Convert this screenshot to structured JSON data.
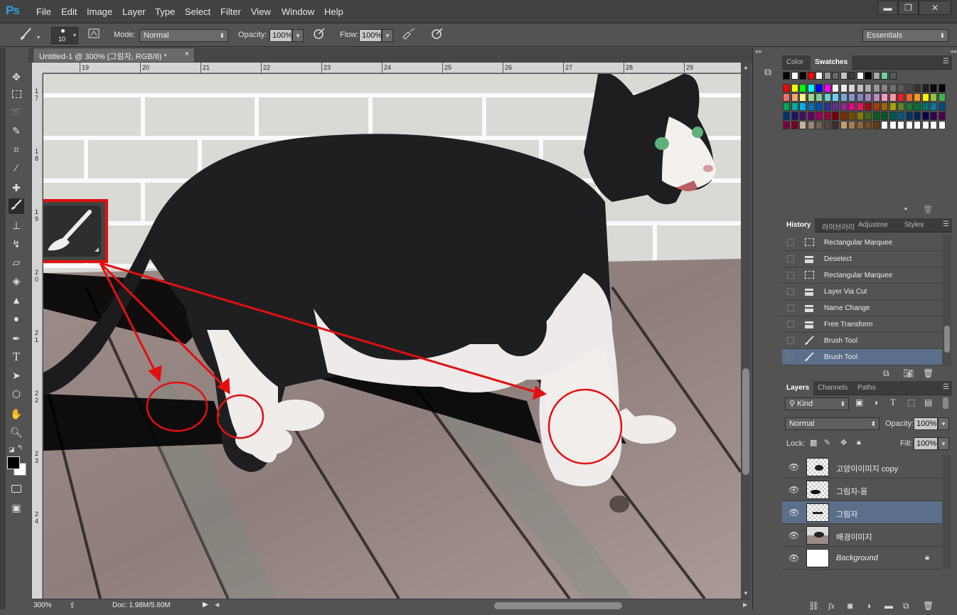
{
  "app": {
    "logo": "Ps"
  },
  "menubar": {
    "items": [
      "File",
      "Edit",
      "Image",
      "Layer",
      "Type",
      "Select",
      "Filter",
      "View",
      "Window",
      "Help"
    ]
  },
  "window_controls": {
    "minimize": "▬",
    "restore": "❐",
    "close": "✕"
  },
  "options_bar": {
    "brush_size": "10",
    "mode_label": "Mode:",
    "mode_value": "Normal",
    "opacity_label": "Opacity:",
    "opacity_value": "100%",
    "flow_label": "Flow:",
    "flow_value": "100%",
    "workspace": "Essentials"
  },
  "document": {
    "tab_title": "Untitled-1 @ 300% (그림자, RGB/8) *",
    "close": "×",
    "ruler_h_ticks": [
      "19",
      "20",
      "21",
      "22",
      "23",
      "24",
      "25",
      "26",
      "27",
      "28",
      "29"
    ],
    "ruler_v_ticks": [
      "1",
      "7",
      "1",
      "8",
      "1",
      "9",
      "2",
      "0",
      "2",
      "1",
      "2",
      "2",
      "2",
      "3",
      "2",
      "4"
    ]
  },
  "status": {
    "zoom": "300%",
    "doc": "Doc: 1.98M/5.60M"
  },
  "color_panel": {
    "tabs": [
      "Color",
      "Swatches"
    ],
    "active_tab": "Swatches"
  },
  "swatches": {
    "row1": [
      "#000000",
      "#ffffff",
      "#000000",
      "#ff0000",
      "#ffffff",
      "#9c9c9c",
      "#676767",
      "#c3c3c3",
      "#3a3a3a",
      "#ffffff",
      "#000000",
      "#a7a7a7",
      "#6fcf9a",
      "#595959"
    ],
    "grid": [
      [
        "#ff0000",
        "#ffff00",
        "#00ff00",
        "#00ffff",
        "#0000ff",
        "#ff00ff",
        "#ffffff",
        "#ebebeb",
        "#d6d6d6",
        "#c2c2c2",
        "#adadad",
        "#999999",
        "#858585",
        "#707070",
        "#5c5c5c",
        "#474747",
        "#333333",
        "#1f1f1f",
        "#0a0a0a",
        "#000000"
      ],
      [
        "#f06f6b",
        "#f8a36a",
        "#fff687",
        "#a0d487",
        "#7dcc9a",
        "#6dcfca",
        "#6dcff6",
        "#7da7d9",
        "#8493ca",
        "#8882be",
        "#a186be",
        "#bd8cbf",
        "#f49ac1",
        "#f5989d",
        "#ed1c24",
        "#f26522",
        "#f7941d",
        "#fff200",
        "#8dc63f",
        "#39b54a"
      ],
      [
        "#00a651",
        "#00a99d",
        "#00aeef",
        "#0072bc",
        "#0054a6",
        "#2e3192",
        "#662d91",
        "#92278f",
        "#ec008c",
        "#ed145b",
        "#9e0b0f",
        "#a0410d",
        "#a3620a",
        "#aba000",
        "#598527",
        "#197b30",
        "#007236",
        "#00746b",
        "#0076a3",
        "#004b80"
      ],
      [
        "#003471",
        "#1b1464",
        "#440e62",
        "#630460",
        "#9e005d",
        "#9e0039",
        "#790000",
        "#7b2e00",
        "#7d4900",
        "#827b00",
        "#406618",
        "#005e20",
        "#005826",
        "#005952",
        "#005b7f",
        "#003663",
        "#002157",
        "#0d004c",
        "#32004b",
        "#4b0049"
      ],
      [
        "#7b0046",
        "#7a0026",
        "#c7b299",
        "#998675",
        "#736357",
        "#534741",
        "#37302a",
        "#c69c6d",
        "#a67c52",
        "#8c6239",
        "#754c24",
        "#603913",
        "#ffffff",
        "#ffffff",
        "#ffffff",
        "#ffffff",
        "#ffffff",
        "#ffffff",
        "#ffffff",
        "#ffffff"
      ]
    ]
  },
  "history_panel": {
    "tabs": [
      "History",
      "라이브러리",
      "Adjustme",
      "Styles"
    ],
    "items": [
      {
        "label": "Rectangular Marquee",
        "icon": "marquee-icon"
      },
      {
        "label": "Deselect",
        "icon": "document-icon"
      },
      {
        "label": "Rectangular Marquee",
        "icon": "marquee-icon"
      },
      {
        "label": "Layer Via Cut",
        "icon": "document-icon"
      },
      {
        "label": "Name Change",
        "icon": "document-icon"
      },
      {
        "label": "Free Transform",
        "icon": "document-icon"
      },
      {
        "label": "Brush Tool",
        "icon": "brush-icon"
      },
      {
        "label": "Brush Tool",
        "icon": "brush-icon"
      }
    ],
    "selected_index": 7
  },
  "layers_panel": {
    "tabs": [
      "Layers",
      "Channels",
      "Paths"
    ],
    "filter": "Kind",
    "blend_mode": "Normal",
    "opacity_label": "Opacity:",
    "opacity_value": "100%",
    "lock_label": "Lock:",
    "fill_label": "Fill:",
    "fill_value": "100%",
    "layers": [
      {
        "name": "고양이이미지 copy",
        "visible": true,
        "thumb": "cat"
      },
      {
        "name": "그림자-몸",
        "visible": true,
        "thumb": "shadow"
      },
      {
        "name": "그림자",
        "visible": true,
        "thumb": "shadow2"
      },
      {
        "name": "배경이미지",
        "visible": true,
        "thumb": "bg"
      },
      {
        "name": "Background",
        "visible": true,
        "thumb": "white",
        "locked": true
      }
    ],
    "selected_index": 2
  },
  "colors": {
    "accent_selected": "#5b6f8a",
    "annotation_red": "#e21010"
  }
}
